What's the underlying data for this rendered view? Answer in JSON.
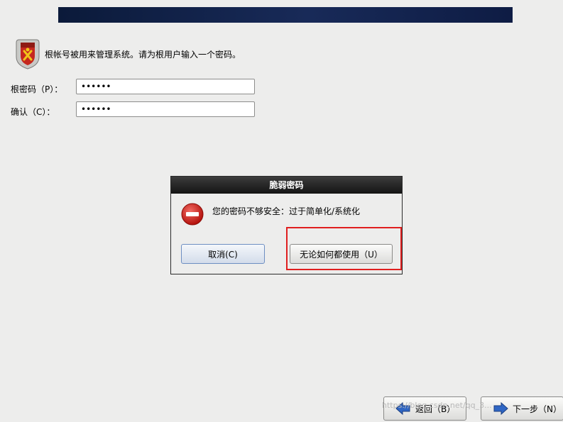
{
  "intro": {
    "message": "根帐号被用来管理系统。请为根用户输入一个密码。"
  },
  "form": {
    "root_password_label": "根密码（P）：",
    "root_password_value": "••••••",
    "confirm_label": "确认（C）：",
    "confirm_value": "••••••"
  },
  "dialog": {
    "title": "脆弱密码",
    "message": "您的密码不够安全：过于简单化/系统化",
    "cancel_label": "取消(C)",
    "use_anyway_label": "无论如何都使用（U）"
  },
  "nav": {
    "back_label": "返回（B）",
    "next_label": "下一步（N）"
  },
  "watermark": "https://blog.csdn.net/qq_3...",
  "colors": {
    "banner": "#0b1a3a",
    "highlight": "#e01f1f",
    "error_icon": "#d11c1c",
    "nav_arrow": "#2f66c4"
  }
}
